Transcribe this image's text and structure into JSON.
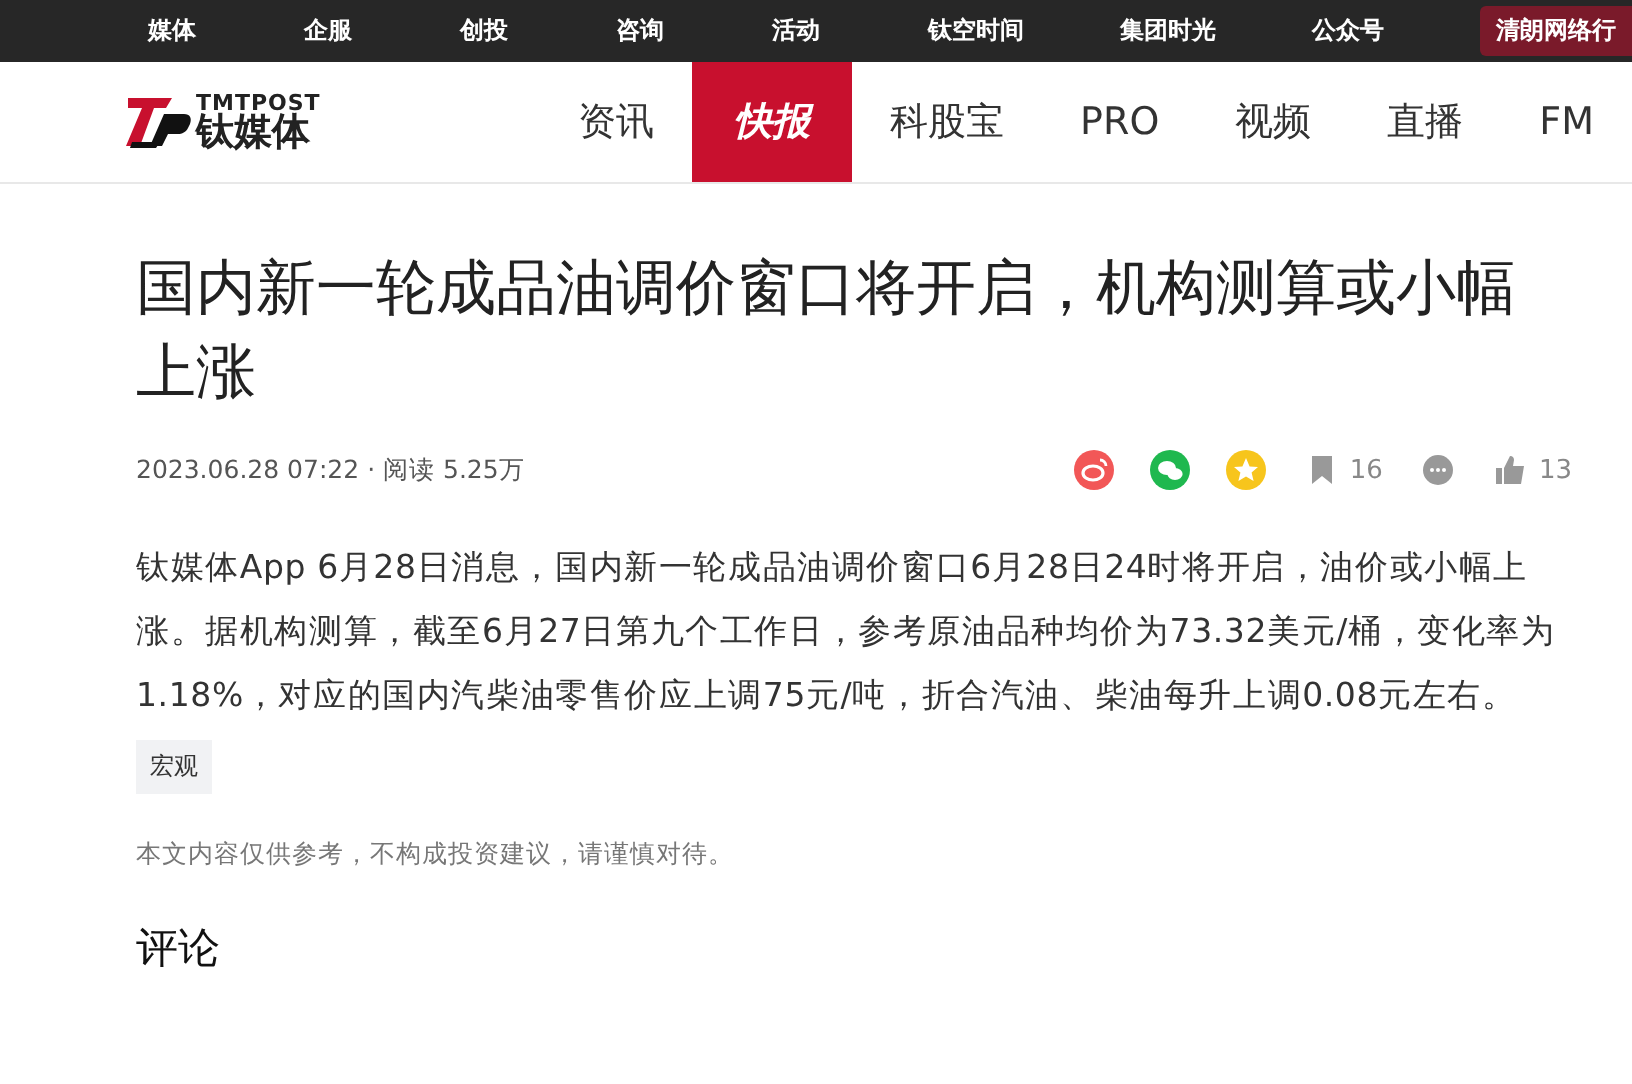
{
  "top_bar": {
    "links": [
      "媒体",
      "企服",
      "创投",
      "咨询",
      "活动",
      "钛空时间",
      "集团时光",
      "公众号"
    ],
    "highlight_button": "清朗网络行"
  },
  "header": {
    "logo": {
      "latin": "TMTPOST",
      "chinese": "钛媒体"
    },
    "nav": [
      {
        "label": "资讯",
        "selected": false
      },
      {
        "label": "快报",
        "selected": true
      },
      {
        "label": "科股宝",
        "selected": false
      },
      {
        "label": "PRO",
        "selected": false
      },
      {
        "label": "视频",
        "selected": false
      },
      {
        "label": "直播",
        "selected": false
      },
      {
        "label": "FM",
        "selected": false
      }
    ]
  },
  "article": {
    "title": "国内新一轮成品油调价窗口将开启，机构测算或小幅上涨",
    "date": "2023.06.28 07:22",
    "separator": "·",
    "reads": "阅读 5.25万",
    "share": [
      {
        "kind": "weibo",
        "color": "#f25757"
      },
      {
        "kind": "wechat",
        "color": "#1fb84f"
      },
      {
        "kind": "star",
        "color": "#f7c51c"
      }
    ],
    "stats": [
      {
        "kind": "bookmark",
        "count": "16"
      },
      {
        "kind": "comment"
      },
      {
        "kind": "like",
        "count": "13"
      }
    ],
    "body": "钛媒体App 6月28日消息，国内新一轮成品油调价窗口6月28日24时将开启，油价或小幅上涨。据机构测算，截至6月27日第九个工作日，参考原油品种均价为73.32美元/桶，变化率为1.18%，对应的国内汽柴油零售价应上调75元/吨，折合汽油、柴油每升上调0.08元左右。",
    "tags": [
      "宏观"
    ],
    "disclaimer": "本文内容仅供参考，不构成投资建议，请谨慎对待。"
  },
  "comments": {
    "heading": "评论"
  }
}
